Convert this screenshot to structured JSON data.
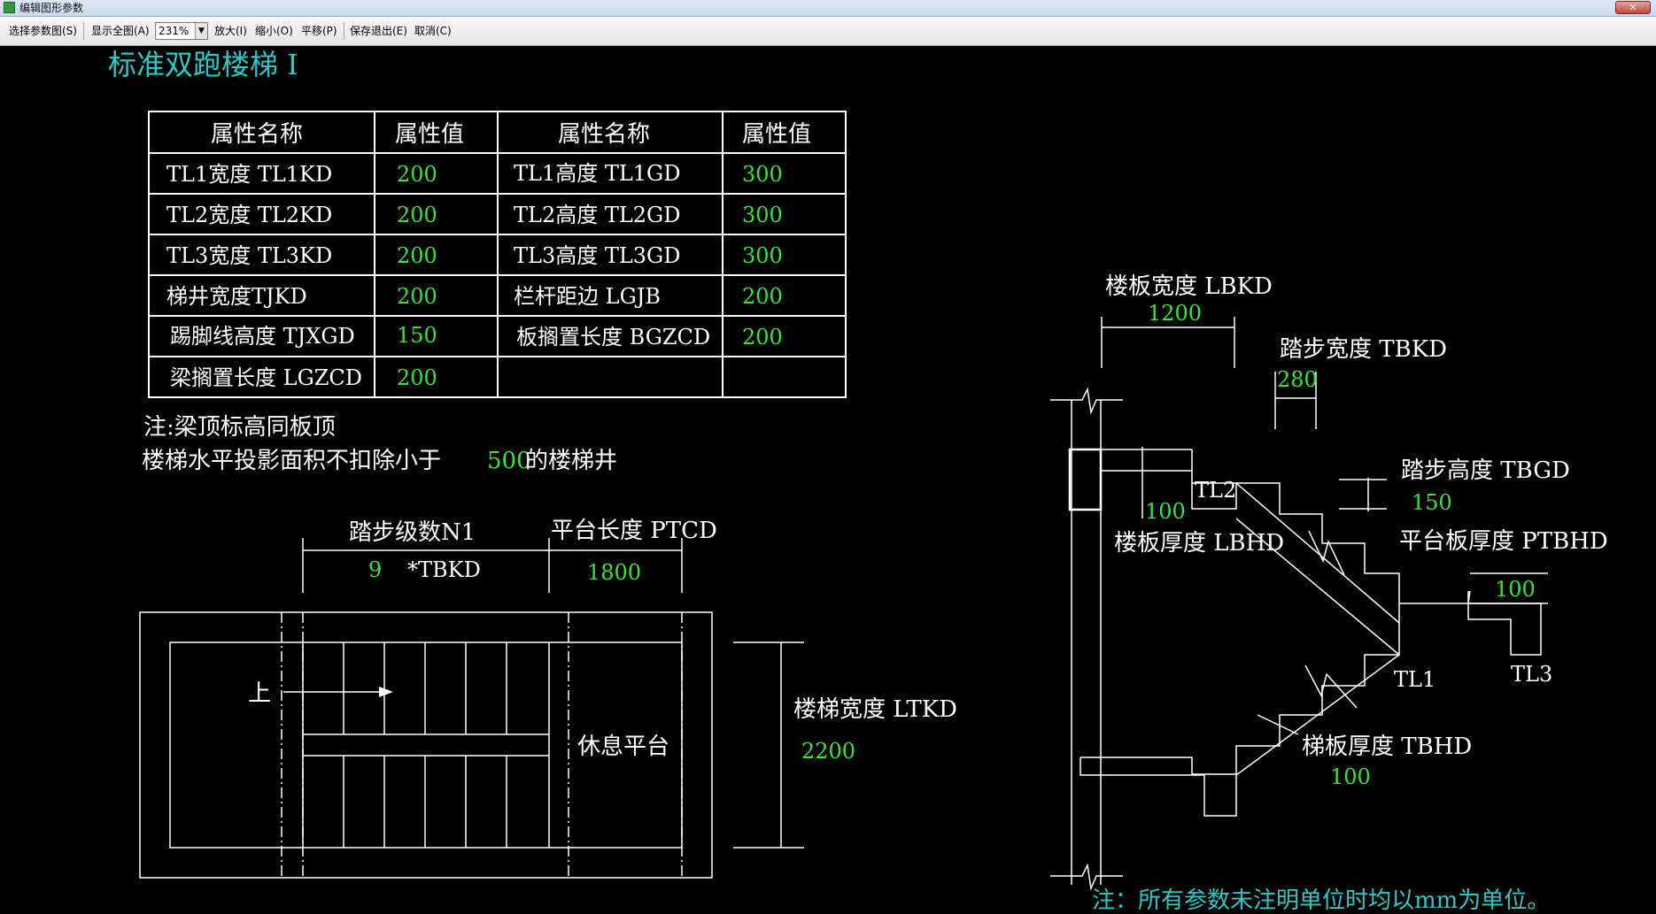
{
  "window": {
    "title": "编辑图形参数",
    "close_label": "✕"
  },
  "toolbar": {
    "select_params": "选择参数图(S)",
    "show_all": "显示全图(A)",
    "zoom_value": "231%",
    "zoom_in": "放大(I)",
    "zoom_out": "缩小(O)",
    "pan": "平移(P)",
    "save_exit": "保存退出(E)",
    "cancel": "取消(C)"
  },
  "drawing": {
    "title": "标准双跑楼梯 I",
    "table": {
      "headers": [
        "属性名称",
        "属性值",
        "属性名称",
        "属性值"
      ],
      "rows": [
        [
          "TL1宽度 TL1KD",
          "200",
          "TL1高度 TL1GD",
          "300"
        ],
        [
          "TL2宽度 TL2KD",
          "200",
          "TL2高度 TL2GD",
          "300"
        ],
        [
          "TL3宽度 TL3KD",
          "200",
          "TL3高度 TL3GD",
          "300"
        ],
        [
          "梯井宽度TJKD",
          "200",
          "栏杆距边 LGJB",
          "200"
        ],
        [
          "踢脚线高度 TJXGD",
          "150",
          "板搁置长度 BGZCD",
          "200"
        ],
        [
          "梁搁置长度 LGZCD",
          "200",
          "",
          ""
        ]
      ]
    },
    "notes": {
      "note1": "注:梁顶标高同板顶",
      "note2_prefix": "楼梯水平投影面积不扣除小于",
      "note2_value": "500",
      "note2_suffix": "的楼梯井"
    },
    "plan": {
      "steps_label": "踏步级数N1",
      "steps_value": "9",
      "steps_unit": "*TBKD",
      "platform_label": "平台长度 PTCD",
      "platform_value": "1800",
      "up_label": "上",
      "rest_label": "休息平台",
      "width_label": "楼梯宽度 LTKD",
      "width_value": "2200"
    },
    "section": {
      "slab_width_label": "楼板宽度 LBKD",
      "slab_width_value": "1200",
      "tread_width_label": "踏步宽度 TBKD",
      "tread_width_value": "280",
      "riser_height_label": "踏步高度 TBGD",
      "riser_height_value": "150",
      "slab_thick_label": "楼板厚度 LBHD",
      "slab_thick_value": "100",
      "platform_thick_label": "平台板厚度 PTBHD",
      "platform_thick_value": "100",
      "stair_thick_label": "梯板厚度 TBHD",
      "stair_thick_value": "100",
      "tl1": "TL1",
      "tl2": "TL2",
      "tl3": "TL3"
    },
    "footer_note": "注：所有参数未注明单位时均以mm为单位。"
  },
  "colors": {
    "title": "#29c9c9",
    "label": "#ffffff",
    "value": "#33e633",
    "line": "#ffffff",
    "footer": "#29c9c9"
  }
}
